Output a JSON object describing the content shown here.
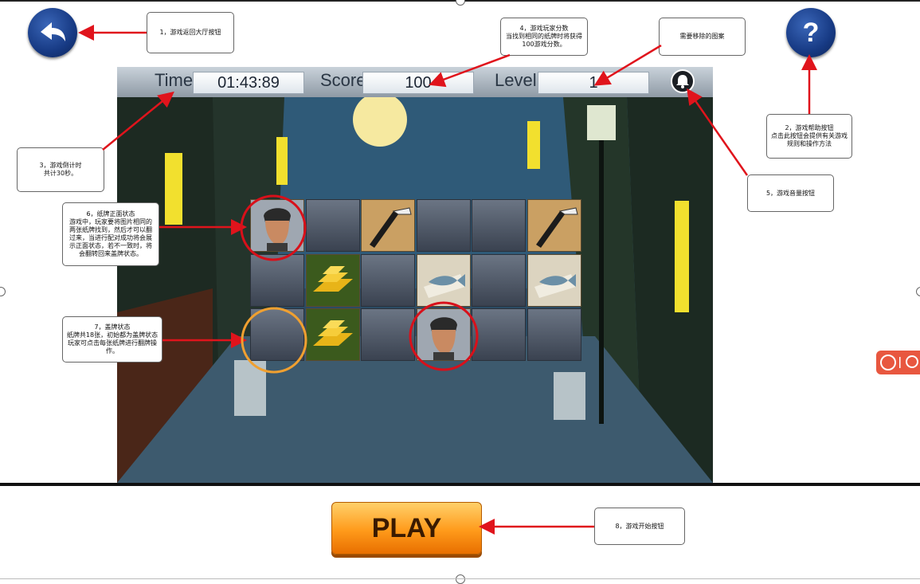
{
  "game": {
    "time_label": "Time:",
    "time_value": "01:43:89",
    "score_label": "Score:",
    "score_value": "100",
    "level_label": "Level:",
    "level_value": "1"
  },
  "play_button": {
    "label": "PLAY"
  },
  "help_button": {
    "symbol": "?"
  },
  "annotations": {
    "back": "1，游戏返回大厅按钮",
    "help": "2，游戏帮助按钮\n点击此按钮会提供有关游戏\n规则和操作方法",
    "timer": "3，游戏倒计时\n共计30秒。",
    "score": "4，游戏玩家分数\n当找到相同的纸牌时将获得\n100游戏分数。",
    "remove": "需要移除的图案",
    "sound": "5，游戏音量按钮",
    "face_up": "6，纸牌正面状态\n游戏中，玩家要将图片相同的\n两张纸牌找到，然后才可以翻\n过来，当进行配对成功将会展\n示正面状态，若不一致时，将\n会翻转回来盖牌状态。",
    "face_down": "7，盖牌状态\n纸牌共18张，初始都为盖牌状态\n玩家可点击每张纸牌进行翻牌操\n作。",
    "play": "8，游戏开始按钮"
  },
  "cards": [
    [
      "face-man",
      "back",
      "razor",
      "back",
      "back",
      "razor"
    ],
    [
      "back",
      "gold",
      "back",
      "fish",
      "back",
      "fish"
    ],
    [
      "back",
      "gold",
      "back",
      "face-man",
      "back",
      "back"
    ]
  ],
  "colors": {
    "annotation_line": "#e0141c",
    "highlight_face": "#d8101a",
    "highlight_back": "#f0a030",
    "play_orange": "#ff9a1a",
    "round_button_blue": "#1c3f8c"
  },
  "icons": {
    "back_button": "back-arrow-icon",
    "help_button": "question-icon",
    "sound_button": "bell-icon",
    "card_razor": "razor-icon",
    "card_gold": "gold-bars-icon",
    "card_fish": "fish-icon",
    "card_face": "man-portrait-icon"
  }
}
